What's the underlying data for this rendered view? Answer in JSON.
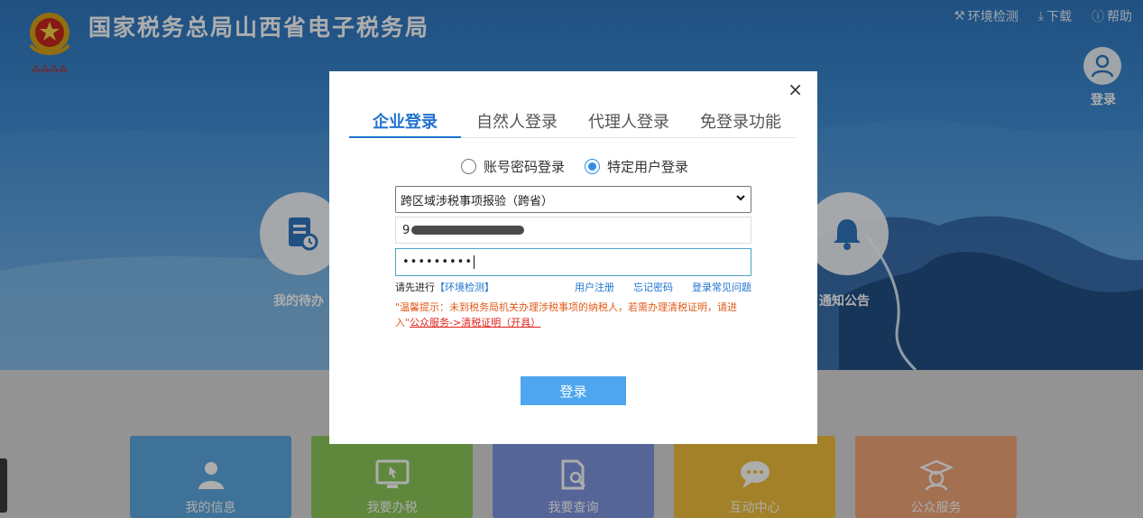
{
  "header": {
    "site_title": "国家税务总局山西省电子税务局",
    "links": [
      {
        "icon": "wrench-icon",
        "glyph": "⚒",
        "label": "环境检测"
      },
      {
        "icon": "download-icon",
        "glyph": "⤓",
        "label": "下载"
      },
      {
        "icon": "help-icon",
        "glyph": "ⓘ",
        "label": "帮助"
      }
    ],
    "user_login_label": "登录"
  },
  "banner_shortcuts": [
    {
      "icon": "todo-clock-icon",
      "label": "我的待办"
    },
    {
      "icon": "bell-icon",
      "label": "通知公告"
    }
  ],
  "tiles": [
    {
      "icon": "person-icon",
      "label": "我的信息",
      "color": "#5ea9e0"
    },
    {
      "icon": "monitor-cursor-icon",
      "label": "我要办税",
      "color": "#8cc95a"
    },
    {
      "icon": "document-search-icon",
      "label": "我要查询",
      "color": "#7f96e0"
    },
    {
      "icon": "chat-bubbles-icon",
      "label": "互动中心",
      "color": "#f1bf3c"
    },
    {
      "icon": "graduate-icon",
      "label": "公众服务",
      "color": "#f0a57a"
    }
  ],
  "login_modal": {
    "close_glyph": "×",
    "tabs": [
      {
        "label": "企业登录",
        "active": true
      },
      {
        "label": "自然人登录",
        "active": false
      },
      {
        "label": "代理人登录",
        "active": false
      },
      {
        "label": "免登录功能",
        "active": false
      }
    ],
    "login_modes": [
      {
        "label": "账号密码登录",
        "selected": false
      },
      {
        "label": "特定用户登录",
        "selected": true
      }
    ],
    "user_type_select": {
      "selected": "跨区域涉税事项报验（跨省）"
    },
    "account_field": {
      "visible_prefix": "9"
    },
    "password_field": {
      "value": "•••••••••"
    },
    "helper": {
      "prefix": "请先进行",
      "env_check_link": "【环境检测】",
      "register_link": "用户注册",
      "forgot_link": "忘记密码",
      "faq_link": "登录常见问题"
    },
    "warm_tip": {
      "text": "\"温馨提示：未到税务局机关办理涉税事项的纳税人，若需办理清税证明，请进入\"",
      "link": "公众服务->清税证明（开具）"
    },
    "submit_label": "登录"
  },
  "colors": {
    "accent": "#1f73d0",
    "button": "#4ea6ee",
    "warning": "#e05a17"
  }
}
